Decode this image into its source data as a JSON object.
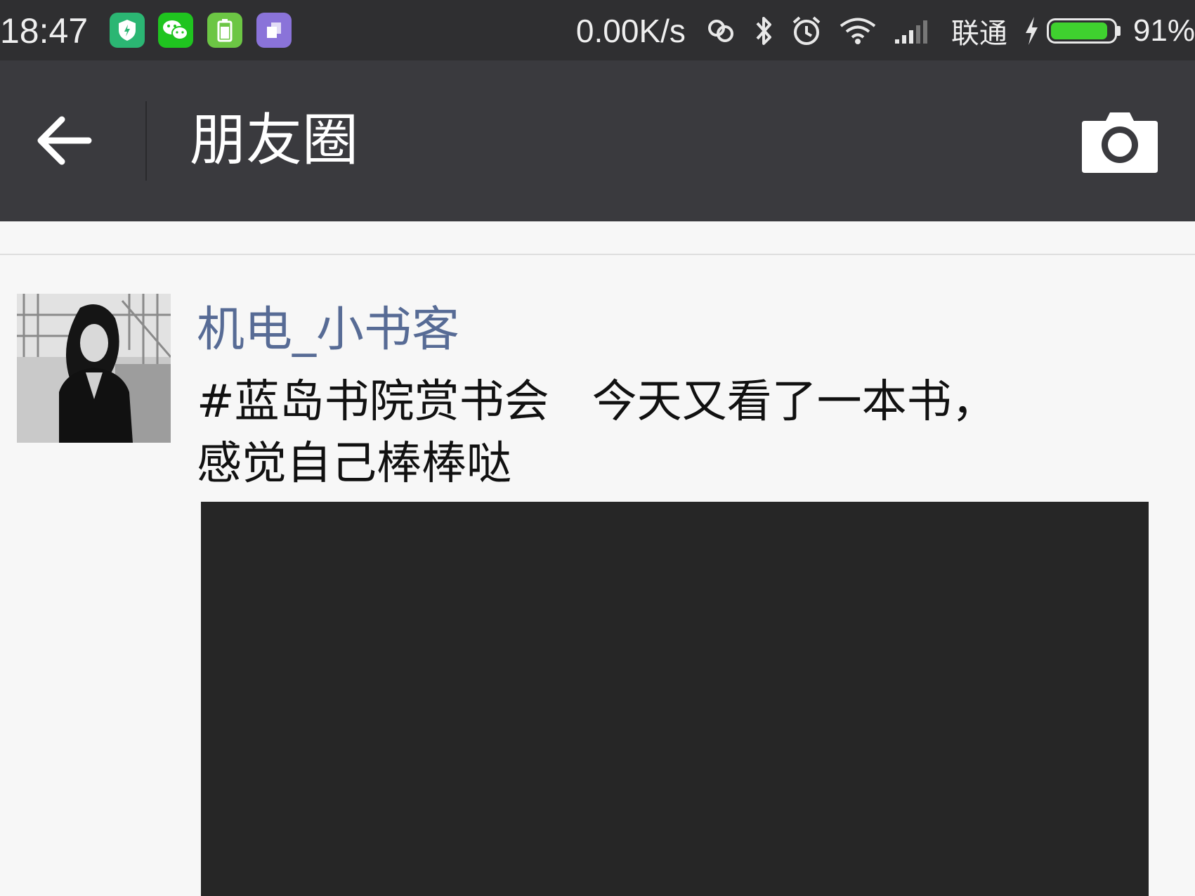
{
  "status_bar": {
    "time": "18:47",
    "net_speed": "0.00K/s",
    "carrier": "联通",
    "battery_percent": "91%",
    "battery_level": 0.91,
    "app_icons": [
      {
        "name": "security-app-icon",
        "color": "#2bb673"
      },
      {
        "name": "wechat-icon",
        "color": "#1fc41f"
      },
      {
        "name": "battery-app-icon",
        "color": "#6cc644"
      },
      {
        "name": "clipboard-app-icon",
        "color": "#8a73d9"
      }
    ],
    "system_icons": [
      "link-icon",
      "bluetooth-icon",
      "alarm-icon",
      "wifi-icon",
      "signal-icon",
      "charging-icon"
    ]
  },
  "header": {
    "title": "朋友圈",
    "back_icon": "arrow-left-icon",
    "camera_icon": "camera-icon"
  },
  "post": {
    "username": "机电_小书客",
    "text": "#蓝岛书院赏书会   今天又看了一本书，\n感觉自己棒棒哒",
    "username_color": "#576b95"
  }
}
